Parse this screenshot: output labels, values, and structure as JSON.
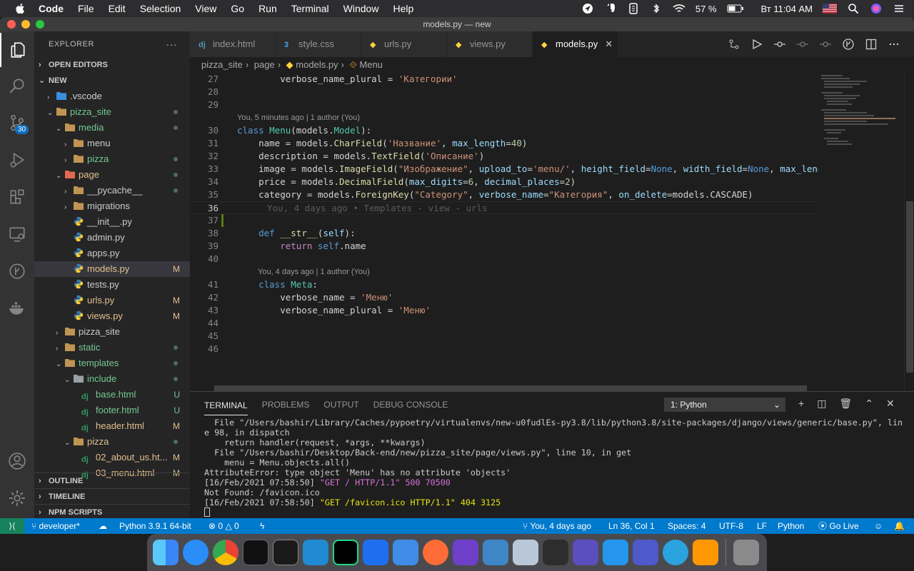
{
  "menubar": {
    "app_name": "Code",
    "items": [
      "File",
      "Edit",
      "Selection",
      "View",
      "Go",
      "Run",
      "Terminal",
      "Window",
      "Help"
    ],
    "battery": "57 %",
    "clock": "Вт 11:04 AM"
  },
  "window": {
    "title": "models.py — new"
  },
  "activity": {
    "scm_badge": "30"
  },
  "sidebar": {
    "title": "EXPLORER",
    "more": "···",
    "open_editors": "OPEN EDITORS",
    "project": "NEW",
    "tree": [
      {
        "label": ".vscode",
        "type": "folder-vscode",
        "depth": 1,
        "chevron": "›",
        "color": "plain",
        "status": ""
      },
      {
        "label": "pizza_site",
        "type": "folder",
        "depth": 1,
        "chevron": "⌄",
        "color": "green",
        "status": "dot"
      },
      {
        "label": "media",
        "type": "folder",
        "depth": 2,
        "chevron": "⌄",
        "color": "green",
        "status": "dot"
      },
      {
        "label": "menu",
        "type": "folder",
        "depth": 3,
        "chevron": "›",
        "color": "plain",
        "status": ""
      },
      {
        "label": "pizza",
        "type": "folder",
        "depth": 3,
        "chevron": "›",
        "color": "green",
        "status": "dot"
      },
      {
        "label": "page",
        "type": "folder-page",
        "depth": 2,
        "chevron": "⌄",
        "color": "yellow",
        "status": "dot"
      },
      {
        "label": "__pycache__",
        "type": "folder",
        "depth": 3,
        "chevron": "›",
        "color": "plain",
        "status": "dot"
      },
      {
        "label": "migrations",
        "type": "folder",
        "depth": 3,
        "chevron": "›",
        "color": "plain",
        "status": ""
      },
      {
        "label": "__init__.py",
        "type": "python",
        "depth": 3,
        "chevron": "",
        "color": "plain",
        "status": ""
      },
      {
        "label": "admin.py",
        "type": "python",
        "depth": 3,
        "chevron": "",
        "color": "plain",
        "status": ""
      },
      {
        "label": "apps.py",
        "type": "python",
        "depth": 3,
        "chevron": "",
        "color": "plain",
        "status": ""
      },
      {
        "label": "models.py",
        "type": "python",
        "depth": 3,
        "chevron": "",
        "color": "yellow",
        "status": "M",
        "selected": true
      },
      {
        "label": "tests.py",
        "type": "python",
        "depth": 3,
        "chevron": "",
        "color": "plain",
        "status": ""
      },
      {
        "label": "urls.py",
        "type": "python",
        "depth": 3,
        "chevron": "",
        "color": "yellow",
        "status": "M"
      },
      {
        "label": "views.py",
        "type": "python",
        "depth": 3,
        "chevron": "",
        "color": "yellow",
        "status": "M"
      },
      {
        "label": "pizza_site",
        "type": "folder",
        "depth": 2,
        "chevron": "›",
        "color": "plain",
        "status": ""
      },
      {
        "label": "static",
        "type": "folder",
        "depth": 2,
        "chevron": "›",
        "color": "green",
        "status": "dot"
      },
      {
        "label": "templates",
        "type": "folder",
        "depth": 2,
        "chevron": "⌄",
        "color": "green",
        "status": "dot"
      },
      {
        "label": "include",
        "type": "folder-include",
        "depth": 3,
        "chevron": "⌄",
        "color": "green",
        "status": "dot"
      },
      {
        "label": "base.html",
        "type": "django",
        "depth": 4,
        "chevron": "",
        "color": "green",
        "status": "U"
      },
      {
        "label": "footer.html",
        "type": "django",
        "depth": 4,
        "chevron": "",
        "color": "green",
        "status": "U"
      },
      {
        "label": "header.html",
        "type": "django",
        "depth": 4,
        "chevron": "",
        "color": "yellow",
        "status": "M"
      },
      {
        "label": "pizza",
        "type": "folder",
        "depth": 3,
        "chevron": "⌄",
        "color": "yellow",
        "status": "dot"
      },
      {
        "label": "02_about_us.ht...",
        "type": "django",
        "depth": 4,
        "chevron": "",
        "color": "yellow",
        "status": "M"
      },
      {
        "label": "03_menu.html",
        "type": "django",
        "depth": 4,
        "chevron": "",
        "color": "yellow",
        "status": "M"
      }
    ],
    "outline": "OUTLINE",
    "timeline": "TIMELINE",
    "npm": "NPM SCRIPTS"
  },
  "tabs": [
    {
      "label": "index.html",
      "icon": "dj",
      "active": false
    },
    {
      "label": "style.css",
      "icon": "css",
      "active": false
    },
    {
      "label": "urls.py",
      "icon": "py",
      "active": false
    },
    {
      "label": "views.py",
      "icon": "py",
      "active": false
    },
    {
      "label": "models.py",
      "icon": "py",
      "active": true
    }
  ],
  "breadcrumb": [
    "pizza_site",
    "page",
    "models.py",
    "Menu"
  ],
  "editor": {
    "codelens_1": "You, 5 minutes ago | 1 author (You)",
    "codelens_2": "You, 4 days ago | 1 author (You)",
    "ghost_blame": "You, 4 days ago • Templates - view - urls",
    "line_numbers": [
      "27",
      "28",
      "29",
      "30",
      "31",
      "32",
      "33",
      "34",
      "35",
      "36",
      "37",
      "38",
      "39",
      "40",
      "41",
      "42",
      "43",
      "44",
      "45",
      "46"
    ]
  },
  "panel": {
    "tabs": [
      "TERMINAL",
      "PROBLEMS",
      "OUTPUT",
      "DEBUG CONSOLE"
    ],
    "terminal_select": "1: Python",
    "lines": [
      "  File \"/Users/bashir/Library/Caches/pypoetry/virtualenvs/new-u0fudlEs-py3.8/lib/python3.8/site-packages/django/views/generic/base.py\", lin",
      "e 98, in dispatch",
      "    return handler(request, *args, **kwargs)",
      "  File \"/Users/bashir/Desktop/Back-end/new/pizza_site/page/views.py\", line 10, in get",
      "    menu = Menu.objects.all()",
      "AttributeError: type object 'Menu' has no attribute 'objects'"
    ],
    "log1_prefix": "[16/Feb/2021 07:58:50] ",
    "log1_msg": "\"GET / HTTP/1.1\" 500 70500",
    "log2": "Not Found: /favicon.ico",
    "log3_prefix": "[16/Feb/2021 07:58:50] ",
    "log3_msg": "\"GET /favicon.ico HTTP/1.1\" 404 3125"
  },
  "statusbar": {
    "branch": "developer*",
    "python": "Python 3.9.1 64-bit",
    "errors": "0",
    "warnings": "0",
    "blame": "You, 4 days ago",
    "position": "Ln 36, Col 1",
    "spaces": "Spaces: 4",
    "encoding": "UTF-8",
    "eol": "LF",
    "language": "Python",
    "golive": "Go Live"
  },
  "dock": [
    "Finder",
    "Safari",
    "Chrome",
    "Activity Monitor",
    "Terminal",
    "VS Code",
    "PyCharm",
    "Xcode",
    "Instruments",
    "Postman",
    "GitHub Desktop",
    "pgAdmin",
    "PostgreSQL",
    "MongoDB Compass",
    "DBeaver",
    "Docker",
    "Teams",
    "Telegram",
    "Sublime Text",
    "Trash"
  ]
}
